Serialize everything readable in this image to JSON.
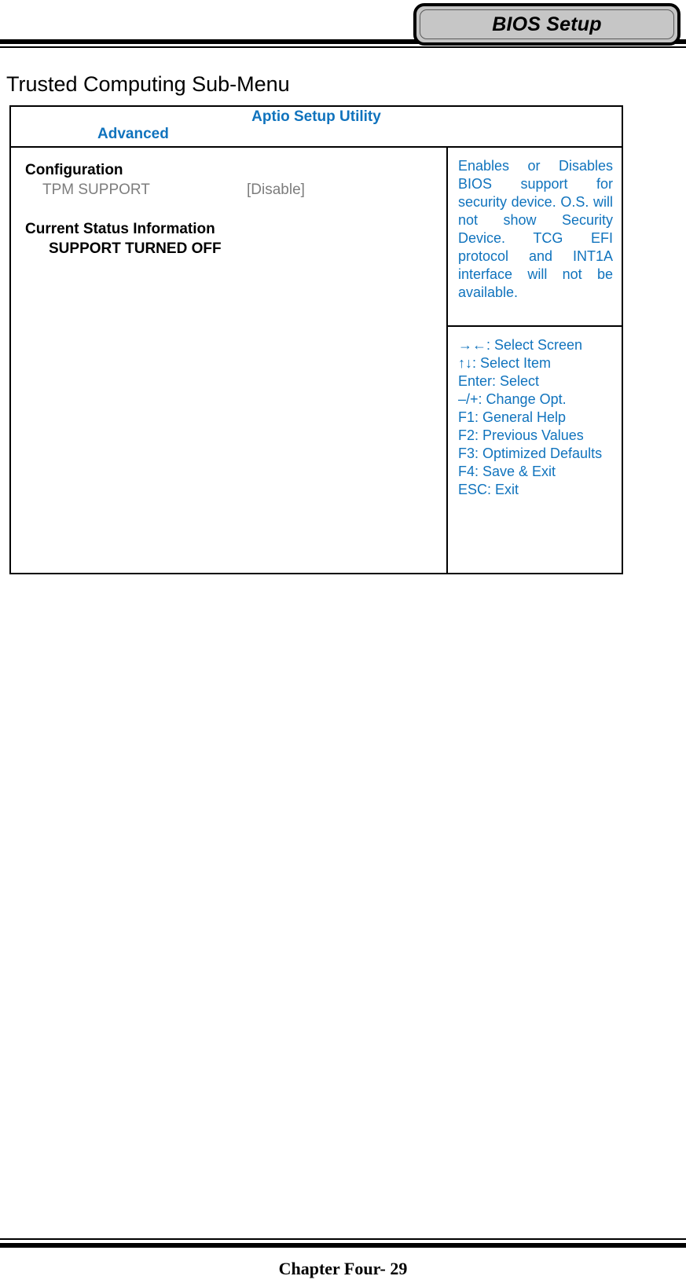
{
  "header": {
    "tab_label": "BIOS Setup"
  },
  "section": {
    "title": "Trusted Computing Sub-Menu"
  },
  "bios": {
    "utility_title": "Aptio Setup Utility",
    "active_menu": "Advanced",
    "accent_color": "#1073bd",
    "disabled_color": "#7d7d7d",
    "groups": [
      {
        "heading": "Configuration",
        "rows": [
          {
            "label": "TPM SUPPORT",
            "value": "[Disable]"
          }
        ]
      },
      {
        "heading": "Current Status Information",
        "status": "SUPPORT TURNED OFF"
      }
    ],
    "help_text": "Enables or Disables BIOS support for security device. O.S. will not show Security Device. TCG EFI protocol and INT1A interface will not be available.",
    "key_hints": [
      "→←: Select Screen",
      "↑↓: Select Item",
      "Enter: Select",
      "–/+: Change Opt.",
      "F1: General Help",
      "F2: Previous Values",
      "F3: Optimized Defaults",
      "F4: Save & Exit",
      "ESC: Exit"
    ]
  },
  "footer": {
    "page_label": "Chapter Four- 29"
  }
}
